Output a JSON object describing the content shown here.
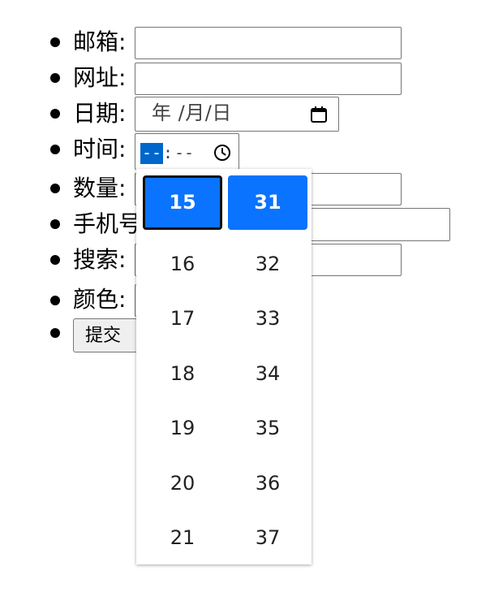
{
  "form": {
    "email_label": "邮箱:",
    "url_label": "网址:",
    "date_label": "日期:",
    "date_placeholder": "年 /月/日",
    "time_label": "时间:",
    "time_hour_placeholder": "--",
    "time_separator": ":",
    "time_minute_placeholder": "--",
    "quantity_label": "数量:",
    "phone_label": "手机号",
    "search_label": "搜索:",
    "color_label": "颜色:",
    "submit_label": "提交"
  },
  "picker": {
    "hours": [
      "15",
      "16",
      "17",
      "18",
      "19",
      "20",
      "21"
    ],
    "minutes": [
      "31",
      "32",
      "33",
      "34",
      "35",
      "36",
      "37"
    ],
    "selected_hour": "15",
    "selected_minute": "31",
    "accent_color": "#0a73ff"
  },
  "icons": {
    "date": "calendar-icon",
    "time": "clock-icon"
  }
}
